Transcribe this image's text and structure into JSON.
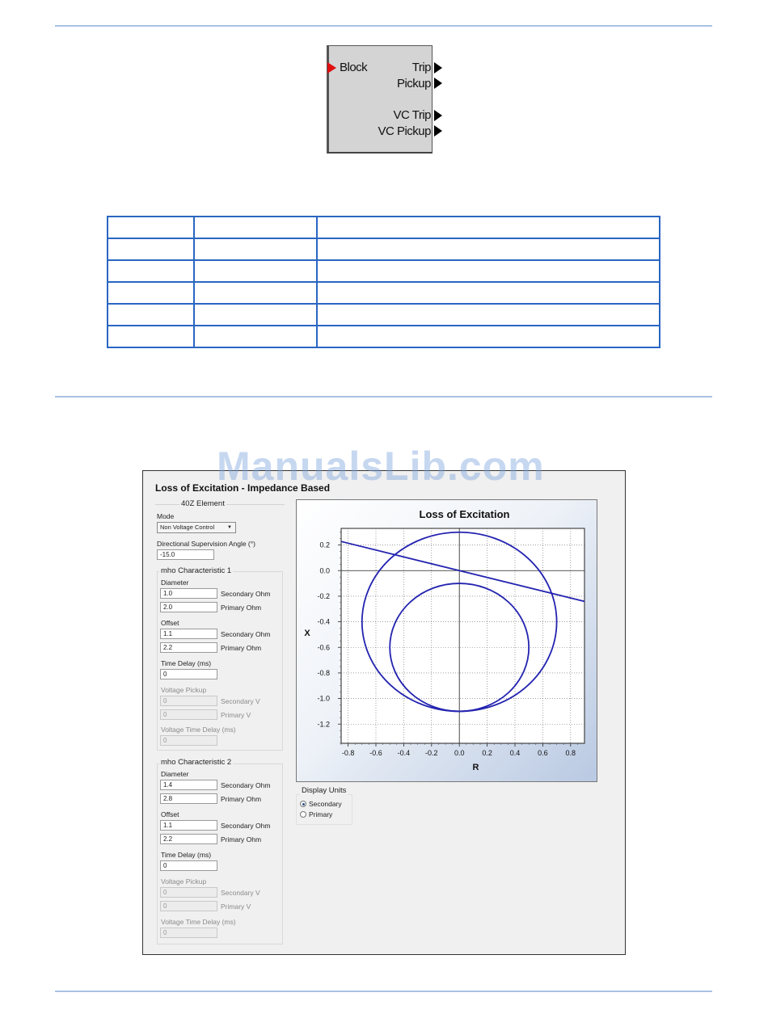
{
  "block": {
    "input": "Block",
    "outputs": [
      "Trip",
      "Pickup",
      "VC Trip",
      "VC Pickup"
    ]
  },
  "table": {
    "rows": [
      [
        "",
        "",
        ""
      ],
      [
        "",
        "",
        ""
      ],
      [
        "",
        "",
        ""
      ],
      [
        "",
        "",
        ""
      ],
      [
        "",
        "",
        ""
      ],
      [
        "",
        "",
        ""
      ]
    ]
  },
  "watermark": "ManualsLib.com",
  "dialog": {
    "title": "Loss of Excitation - Impedance Based",
    "element_group": "40Z Element",
    "mode_label": "Mode",
    "mode_value": "Non Voltage Control",
    "dsa_label": "Directional Supervision Angle (°)",
    "dsa_value": "-15.0",
    "mho1": {
      "title": "mho Characteristic 1",
      "diameter_label": "Diameter",
      "diameter_secondary": "1.0",
      "diameter_primary": "2.0",
      "offset_label": "Offset",
      "offset_secondary": "1.1",
      "offset_primary": "2.2",
      "time_delay_label": "Time Delay (ms)",
      "time_delay": "0",
      "voltage_pickup_label": "Voltage Pickup",
      "voltage_secondary": "0",
      "voltage_primary": "0",
      "voltage_time_delay_label": "Voltage Time Delay (ms)",
      "voltage_time_delay": "0"
    },
    "mho2": {
      "title": "mho Characteristic 2",
      "diameter_label": "Diameter",
      "diameter_secondary": "1.4",
      "diameter_primary": "2.8",
      "offset_label": "Offset",
      "offset_secondary": "1.1",
      "offset_primary": "2.2",
      "time_delay_label": "Time Delay (ms)",
      "time_delay": "0",
      "voltage_pickup_label": "Voltage Pickup",
      "voltage_secondary": "0",
      "voltage_primary": "0",
      "voltage_time_delay_label": "Voltage Time Delay (ms)",
      "voltage_time_delay": "0"
    },
    "units": {
      "secondary_ohm": "Secondary Ohm",
      "primary_ohm": "Primary Ohm",
      "secondary_v": "Secondary V",
      "primary_v": "Primary V"
    },
    "display_units": {
      "title": "Display Units",
      "options": [
        "Secondary",
        "Primary"
      ],
      "selected": "Secondary"
    }
  },
  "chart_data": {
    "type": "scatter",
    "title": "Loss of Excitation",
    "xlabel": "R",
    "ylabel": "X",
    "xlim": [
      -0.85,
      0.9
    ],
    "ylim": [
      -1.35,
      0.33
    ],
    "xticks": [
      "-0.8",
      "-0.6",
      "-0.4",
      "-0.2",
      "0.0",
      "0.2",
      "0.4",
      "0.6",
      "0.8"
    ],
    "yticks": [
      "0.2",
      "0.0",
      "-0.2",
      "-0.4",
      "-0.6",
      "-0.8",
      "-1.0",
      "-1.2"
    ],
    "grid": true,
    "circles": [
      {
        "center_r": 0.0,
        "center_x": -0.4,
        "radius": 0.7
      },
      {
        "center_r": 0.0,
        "center_x": -0.6,
        "radius": 0.5
      }
    ],
    "direction_line": {
      "angle_deg": -15.0,
      "through": [
        0,
        0
      ]
    },
    "series_color": "#2323b0"
  }
}
